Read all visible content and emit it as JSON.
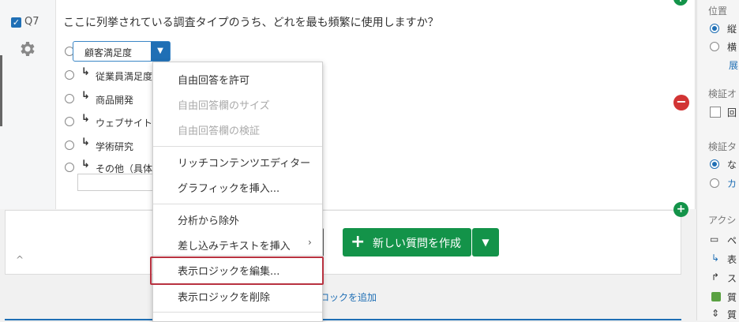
{
  "question": {
    "number": "Q7",
    "text": "ここに列挙されている調査タイプのうち、どれを最も頻繁に使用しますか？",
    "dropdown_value": "顧客満足度",
    "options": [
      "従業員満足度",
      "商品開発",
      "ウェブサイト",
      "学術研究",
      "その他（具体"
    ]
  },
  "menu": {
    "allow_text": "自由回答を許可",
    "text_size": "自由回答欄のサイズ",
    "text_validation": "自由回答欄の検証",
    "rich_editor": "リッチコンテンツエディター",
    "insert_graphic": "グラフィックを挿入...",
    "exclude_analysis": "分析から除外",
    "insert_piped": "差し込みテキストを挿入",
    "edit_display_logic": "表示ロジックを編集...",
    "remove_display_logic": "表示ロジックを削除"
  },
  "toolbar": {
    "new_question": "新しい質問を作成",
    "add_logic_link": "ロックを追加"
  },
  "panel": {
    "position_label": "位置",
    "vertical": "縦",
    "horizontal": "横",
    "expand": "展",
    "validation_options_label": "検証オ",
    "validation_check": "回",
    "validation_type_label": "検証タ",
    "none": "な",
    "custom": "カ",
    "actions_label": "アクシ",
    "action1": "ペ",
    "action2": "表",
    "action3": "ス",
    "action4": "質",
    "action5": "質"
  },
  "colors": {
    "accent": "#1f6fb5",
    "green": "#139349",
    "red": "#d23434",
    "highlight": "#b83240"
  }
}
